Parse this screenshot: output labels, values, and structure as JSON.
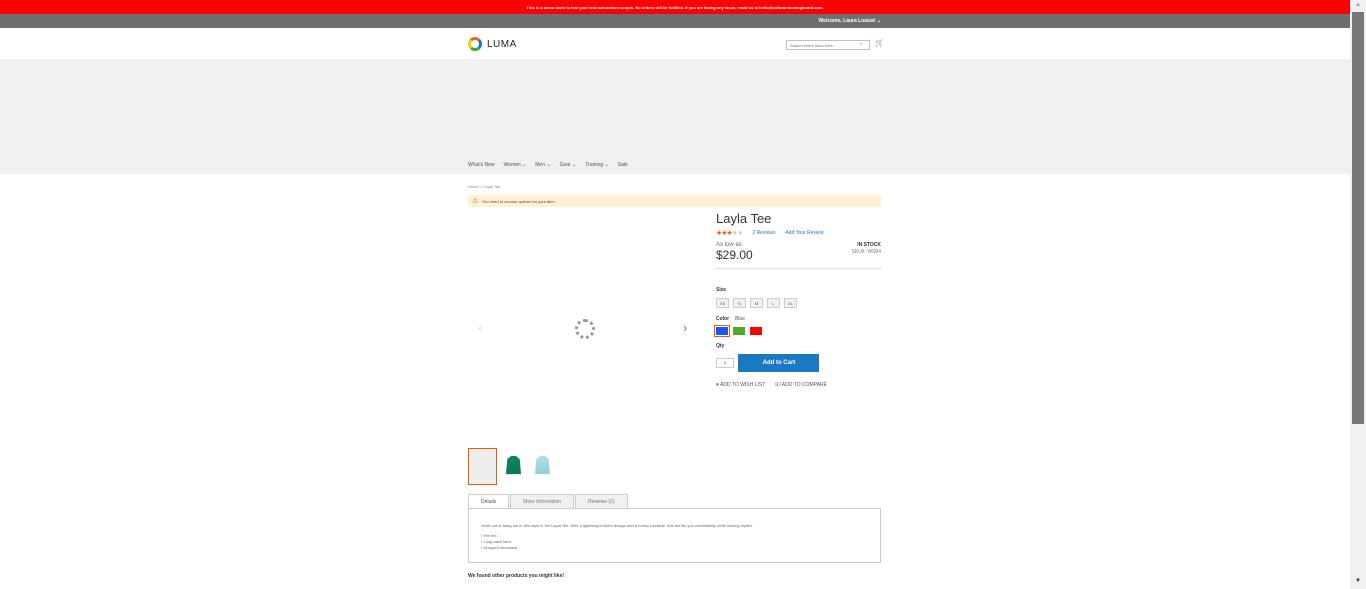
{
  "banner": "This is a demo store to test your test automation scripts. No orders will be fulfilled. If you are facing any issue, email us at hello@softwaretestingboard.com.",
  "header": {
    "welcome": "Welcome, Laura Loaiza!",
    "logo": "LUMA",
    "search_placeholder": "Search entire store here...",
    "search_icon": "search-icon",
    "cart_icon": "cart-icon"
  },
  "nav": [
    "What's New",
    "Women",
    "Men",
    "Gear",
    "Training",
    "Sale"
  ],
  "breadcrumb": {
    "home": "Home",
    "separator": ">",
    "current": "Layla Tee"
  },
  "message": "You need to choose options for your item.",
  "product": {
    "title": "Layla Tee",
    "rating": 3,
    "review_count": "2",
    "reviews_label": "Reviews",
    "add_review": "Add Your Review",
    "as_low_as": "As low as",
    "price": "$29.00",
    "stock": "IN STOCK",
    "sku_label": "SKU#:",
    "sku": "WS04",
    "size_label": "Size",
    "sizes": [
      "XS",
      "S",
      "M",
      "L",
      "XL"
    ],
    "color_label": "Color",
    "selected_color": "Blue",
    "colors": [
      "#1857f7",
      "#53a828",
      "#ff0000"
    ],
    "qty_label": "Qty",
    "qty": "1",
    "add_to_cart": "Add to Cart",
    "wish_list": "Add to Wish List",
    "compare": "Add to Compare"
  },
  "tabs": [
    "Details",
    "More Information",
    "Reviews (2)"
  ],
  "details": {
    "description": "Work out or hang out in this style in the Layla Tee. With a lightweight sheer design and a roomy neckline, this tee fits you comfortably while looking stylish.",
    "bullets": [
      "• Tee tee.",
      "• Long back hem.",
      "• Dropped shoulders."
    ]
  },
  "recommendations": "We found other products you might like!"
}
